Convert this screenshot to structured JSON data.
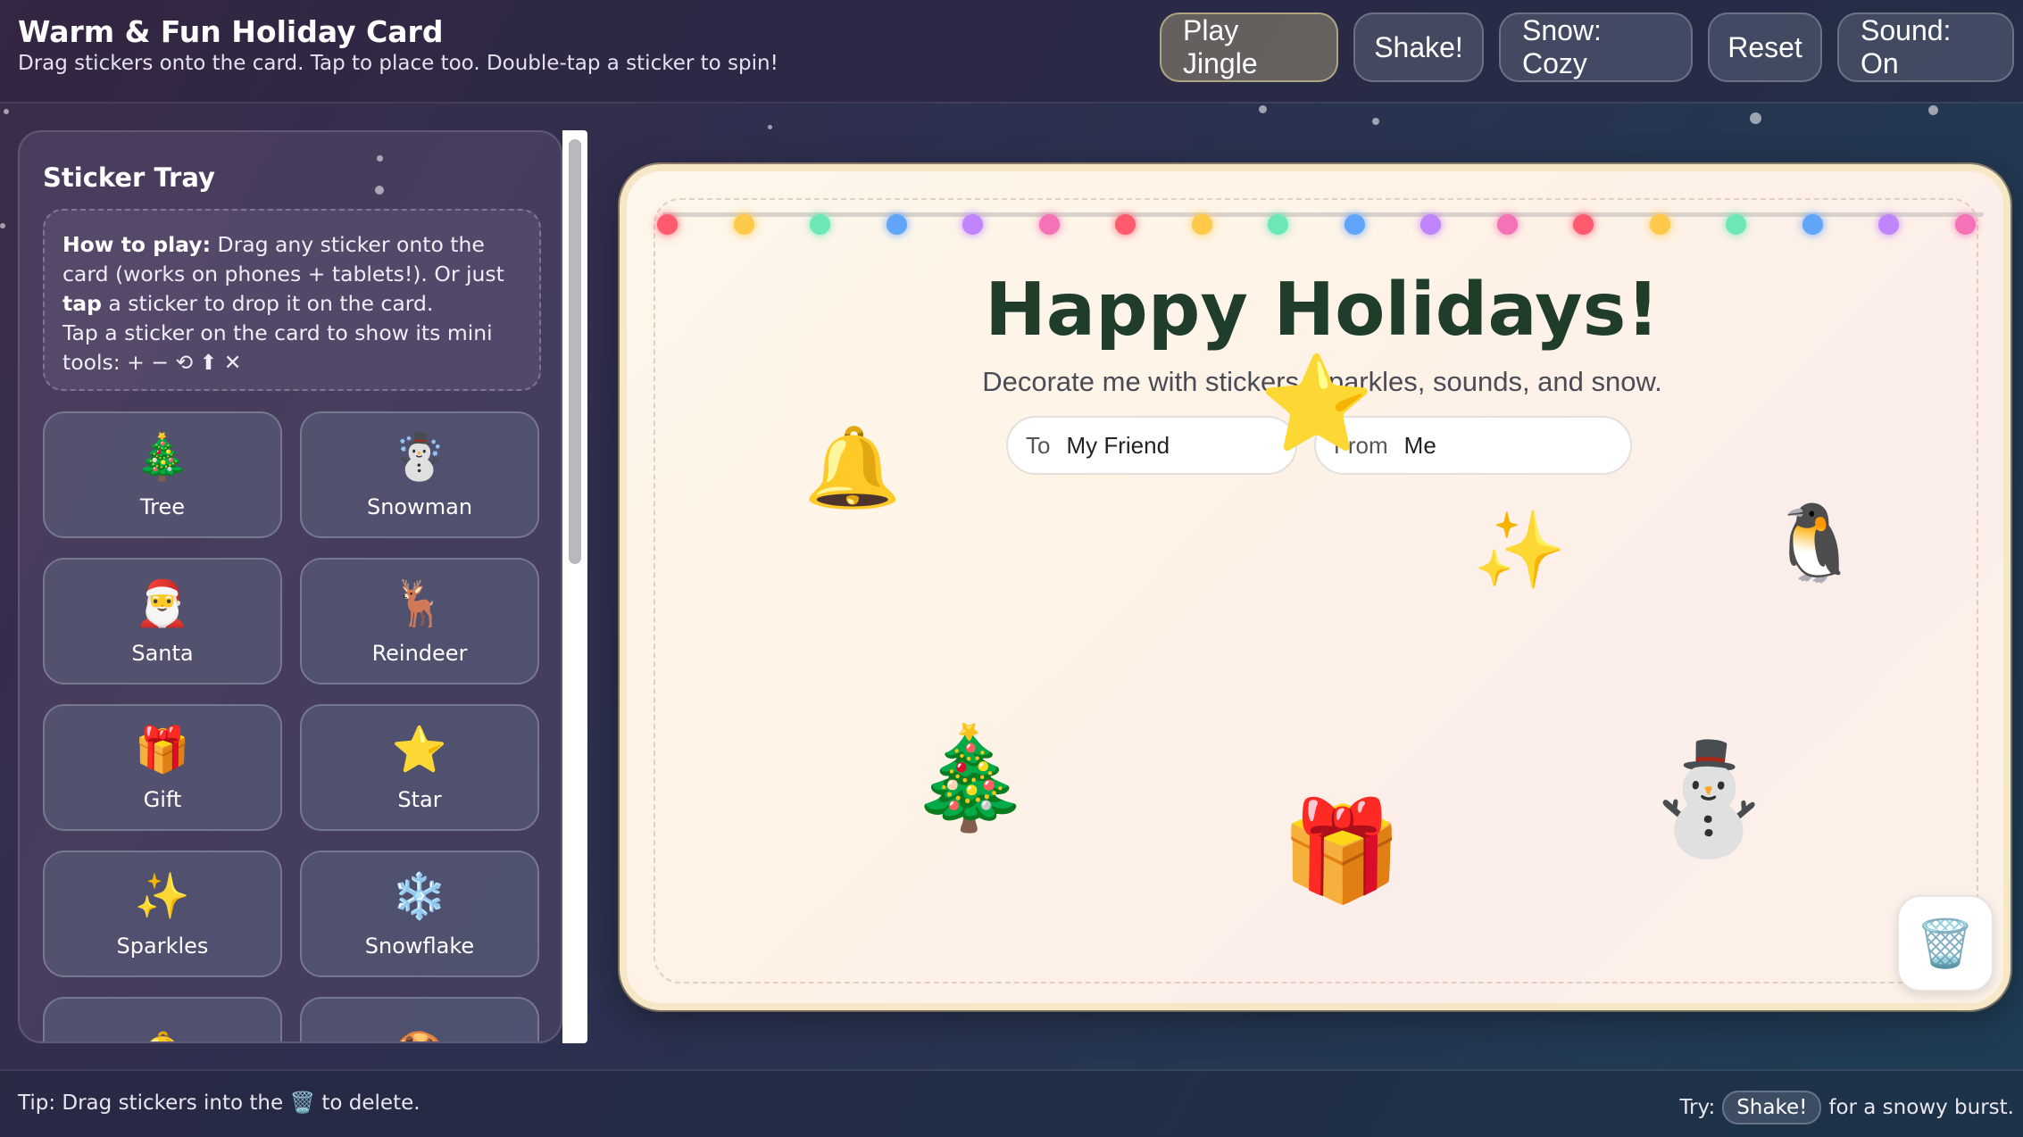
{
  "header": {
    "title": "Warm & Fun Holiday Card",
    "subtitle": "Drag stickers onto the card. Tap to place too. Double-tap a sticker to spin!",
    "buttons": {
      "play_jingle": "Play Jingle",
      "shake": "Shake!",
      "snow": "Snow: Cozy",
      "reset": "Reset",
      "sound": "Sound: On"
    }
  },
  "tray": {
    "title": "Sticker Tray",
    "howto": {
      "lead": "How to play:",
      "text1": " Drag any sticker onto the card (works on phones + tablets!). Or just ",
      "tap": "tap",
      "text2": " a sticker to drop it on the card.",
      "text3": "Tap a sticker on the card to show its mini tools: + − ⟲ ⬆ ✕"
    },
    "stickers": [
      {
        "emoji": "🎄",
        "label": "Tree"
      },
      {
        "emoji": "☃️",
        "label": "Snowman"
      },
      {
        "emoji": "🎅",
        "label": "Santa"
      },
      {
        "emoji": "🦌",
        "label": "Reindeer"
      },
      {
        "emoji": "🎁",
        "label": "Gift"
      },
      {
        "emoji": "⭐",
        "label": "Star"
      },
      {
        "emoji": "✨",
        "label": "Sparkles"
      },
      {
        "emoji": "❄️",
        "label": "Snowflake"
      },
      {
        "emoji": "🔔",
        "label": ""
      },
      {
        "emoji": "🍪",
        "label": ""
      }
    ]
  },
  "card": {
    "title": "Happy Holidays!",
    "subtitle": "Decorate me with stickers, sparkles, sounds, and snow.",
    "to_label": "To",
    "to_value": "My Friend",
    "from_label": "From",
    "from_value": "Me",
    "light_colors": [
      "#ff5a6e",
      "#ffc94a",
      "#6ee7b7",
      "#60a5fa",
      "#c084fc",
      "#f472b6",
      "#ff5a6e",
      "#ffc94a",
      "#6ee7b7",
      "#60a5fa",
      "#c084fc",
      "#f472b6",
      "#ff5a6e",
      "#ffc94a",
      "#6ee7b7",
      "#60a5fa",
      "#c084fc",
      "#f472b6"
    ],
    "placed_stickers": {
      "bell": "🔔",
      "star": "⭐",
      "sparkles": "✨",
      "penguin": "🐧",
      "tree": "🎄",
      "gift": "🎁",
      "snowman": "⛄"
    },
    "trash_icon": "🗑️"
  },
  "footer": {
    "tip_before": "Tip: Drag stickers into the ",
    "tip_icon": "🗑️",
    "tip_after": " to delete.",
    "try_label": "Try:",
    "try_pill": "Shake!",
    "try_after": "for a snowy burst."
  }
}
